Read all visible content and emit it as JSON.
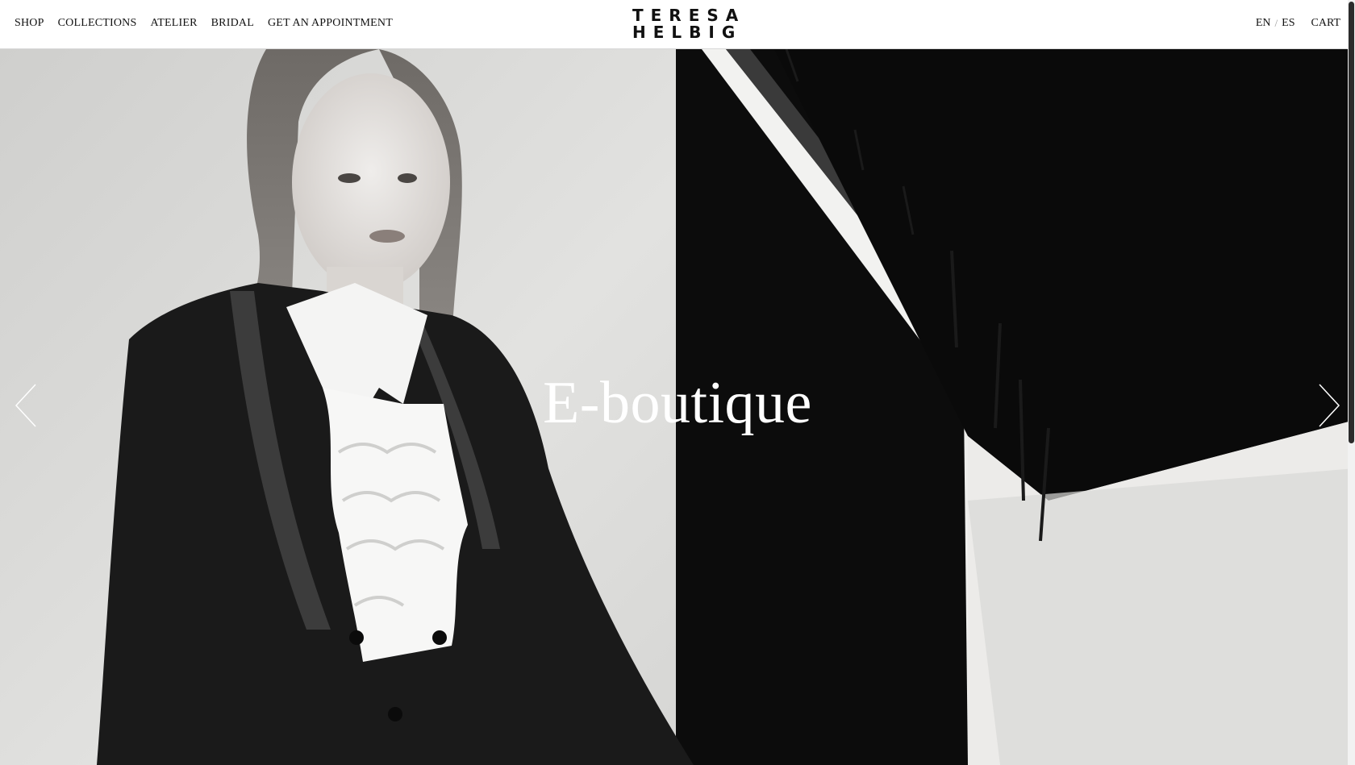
{
  "header": {
    "nav_left": [
      {
        "label": "SHOP"
      },
      {
        "label": "COLLECTIONS"
      },
      {
        "label": "ATELIER"
      },
      {
        "label": "BRIDAL"
      },
      {
        "label": "GET AN APPOINTMENT"
      }
    ],
    "logo": {
      "line1": "TERESA",
      "line2": "HELBIG"
    },
    "languages": {
      "en": "EN",
      "separator": "/",
      "es": "ES"
    },
    "cart_label": "CART"
  },
  "hero": {
    "title": "E-boutique",
    "prev_icon": "chevron-left-icon",
    "next_icon": "chevron-right-icon"
  },
  "colors": {
    "text": "#111111",
    "background": "#ffffff",
    "hero_text": "#ffffff"
  }
}
